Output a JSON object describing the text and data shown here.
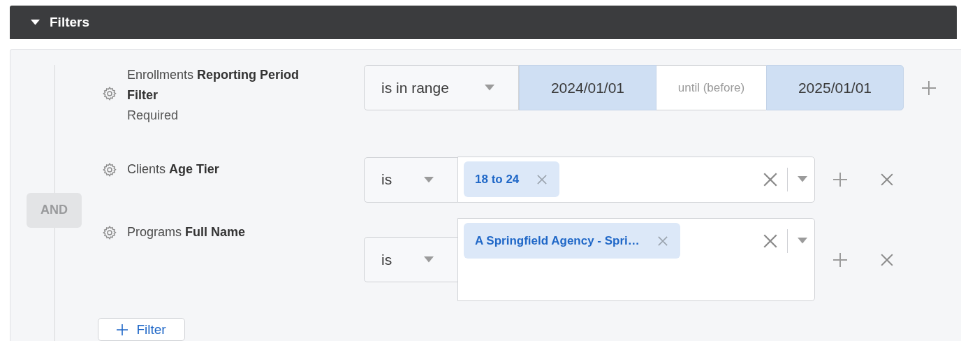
{
  "header": {
    "title": "Filters",
    "expanded": true
  },
  "group": {
    "operator": "AND"
  },
  "filters": [
    {
      "kind": "range",
      "label": "Enrollments **Reporting Period Filter**",
      "note": "Required",
      "operator": "is in range",
      "start": "2024/01/01",
      "separator": "until (before)",
      "end": "2025/01/01",
      "removable": false
    },
    {
      "kind": "multi",
      "label": "Clients **Age Tier**",
      "operator": "is",
      "values": [
        "18 to 24"
      ],
      "input_wrapped": false,
      "removable": true
    },
    {
      "kind": "multi",
      "label": "Programs **Full Name**",
      "operator": "is",
      "values": [
        "A Springfield Agency - Spri…"
      ],
      "input_wrapped": true,
      "removable": true
    }
  ],
  "add_button": "Filter"
}
